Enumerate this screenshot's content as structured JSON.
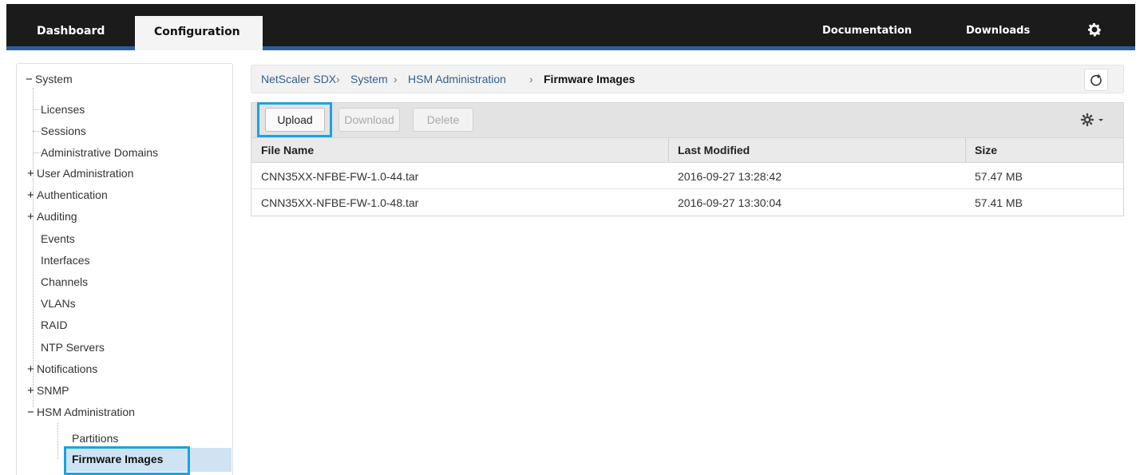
{
  "topnav": {
    "tabs": [
      {
        "label": "Dashboard",
        "active": false
      },
      {
        "label": "Configuration",
        "active": true
      }
    ],
    "links": [
      "Documentation",
      "Downloads"
    ],
    "settings_icon": "gear-icon"
  },
  "sidebar": {
    "root": {
      "label": "System",
      "expanded": true
    },
    "items": [
      {
        "label": "Licenses",
        "expander": ""
      },
      {
        "label": "Sessions",
        "expander": ""
      },
      {
        "label": "Administrative Domains",
        "expander": ""
      },
      {
        "label": "User Administration",
        "expander": "+"
      },
      {
        "label": "Authentication",
        "expander": "+"
      },
      {
        "label": "Auditing",
        "expander": "+"
      },
      {
        "label": "Events",
        "expander": ""
      },
      {
        "label": "Interfaces",
        "expander": ""
      },
      {
        "label": "Channels",
        "expander": ""
      },
      {
        "label": "VLANs",
        "expander": ""
      },
      {
        "label": "RAID",
        "expander": ""
      },
      {
        "label": "NTP Servers",
        "expander": ""
      },
      {
        "label": "Notifications",
        "expander": "+"
      },
      {
        "label": "SNMP",
        "expander": "+"
      },
      {
        "label": "HSM Administration",
        "expander": "−"
      }
    ],
    "hsm_children": [
      {
        "label": "Partitions",
        "selected": false
      },
      {
        "label": "Firmware Images",
        "selected": true
      }
    ]
  },
  "breadcrumb": {
    "items": [
      "NetScaler SDX",
      "System",
      "HSM Administration"
    ],
    "current": "Firmware Images",
    "separator": "›"
  },
  "toolbar": {
    "upload_label": "Upload",
    "download_label": "Download",
    "delete_label": "Delete"
  },
  "table": {
    "columns": [
      "File Name",
      "Last Modified",
      "Size"
    ],
    "rows": [
      [
        "CNN35XX-NFBE-FW-1.0-44.tar",
        "2016-09-27 13:28:42",
        "57.47 MB"
      ],
      [
        "CNN35XX-NFBE-FW-1.0-48.tar",
        "2016-09-27 13:30:04",
        "57.41 MB"
      ]
    ]
  },
  "colors": {
    "topbar": "#1b1b1b",
    "accent_line": "#2e5f96",
    "highlight_box": "#1aa3e2",
    "selected_row": "#cfe3f3",
    "link": "#35608a"
  }
}
